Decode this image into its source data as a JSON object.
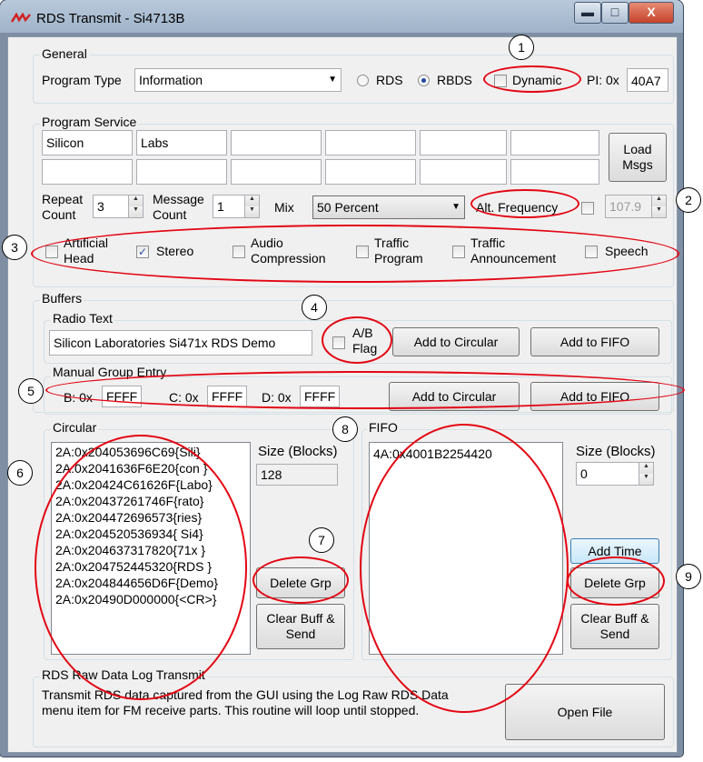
{
  "window": {
    "title": "RDS Transmit - Si4713B",
    "controls": {
      "minimize": "▬",
      "maximize": "□",
      "close": "X"
    }
  },
  "general": {
    "label": "General",
    "program_type_label": "Program Type",
    "program_type_value": "Information",
    "rds_label": "RDS",
    "rbds_label": "RBDS",
    "rbds_selected": true,
    "dynamic_label": "Dynamic",
    "pi_label": "PI: 0x",
    "pi_value": "40A7"
  },
  "program_service": {
    "label": "Program Service",
    "row1": [
      "Silicon",
      "Labs",
      "",
      "",
      "",
      ""
    ],
    "row2": [
      "",
      "",
      "",
      "",
      "",
      ""
    ],
    "load_msgs": "Load Msgs",
    "repeat_count_label": "Repeat Count",
    "repeat_count_value": "3",
    "message_count_label": "Message Count",
    "message_count_value": "1",
    "mix_label": "Mix",
    "mix_value": "50 Percent",
    "alt_freq_label": "Alt. Frequency",
    "alt_freq_value": "107.9",
    "flags": [
      {
        "label": "Artificial Head",
        "checked": false
      },
      {
        "label": "Stereo",
        "checked": true
      },
      {
        "label": "Audio Compression",
        "checked": false
      },
      {
        "label": "Traffic Program",
        "checked": false
      },
      {
        "label": "Traffic Announcement",
        "checked": false
      },
      {
        "label": "Speech",
        "checked": false
      }
    ]
  },
  "buffers": {
    "label": "Buffers",
    "radio_text": {
      "label": "Radio Text",
      "value": "Silicon Laboratories Si471x RDS Demo",
      "ab_flag": "A/B Flag",
      "add_circular": "Add to Circular",
      "add_fifo": "Add to FIFO"
    },
    "manual_group": {
      "label": "Manual Group Entry",
      "b_label": "B: 0x",
      "b_value": "FFFF",
      "c_label": "C: 0x",
      "c_value": "FFFF",
      "d_label": "D: 0x",
      "d_value": "FFFF",
      "add_circular": "Add to Circular",
      "add_fifo": "Add to FIFO"
    },
    "circular": {
      "label": "Circular",
      "items": [
        "2A:0x204053696C69{Sili}",
        "2A:0x2041636F6E20{con }",
        "2A:0x20424C61626F{Labo}",
        "2A:0x20437261746F{rato}",
        "2A:0x204472696573{ries}",
        "2A:0x204520536934{ Si4}",
        "2A:0x204637317820{71x }",
        "2A:0x204752445320{RDS }",
        "2A:0x204844656D6F{Demo}",
        "2A:0x20490D000000{<CR>}"
      ],
      "size_label": "Size (Blocks)",
      "size_value": "128",
      "delete_grp": "Delete Grp",
      "clear_send": "Clear Buff & Send"
    },
    "fifo": {
      "label": "FIFO",
      "items": [
        "4A:0x4001B2254420"
      ],
      "size_label": "Size (Blocks)",
      "size_value": "0",
      "add_time": "Add Time",
      "delete_grp": "Delete Grp",
      "clear_send": "Clear Buff & Send"
    }
  },
  "raw_log": {
    "label": "RDS Raw Data Log Transmit",
    "description": "Transmit RDS data captured from the GUI using the Log Raw RDS Data menu item for FM receive parts.  This routine will loop until stopped.",
    "open_file": "Open File"
  },
  "annotations": [
    "1",
    "2",
    "3",
    "4",
    "5",
    "6",
    "7",
    "8",
    "9"
  ],
  "colors": {
    "annotation": "#e30613",
    "accent": "#1f4aa0"
  }
}
